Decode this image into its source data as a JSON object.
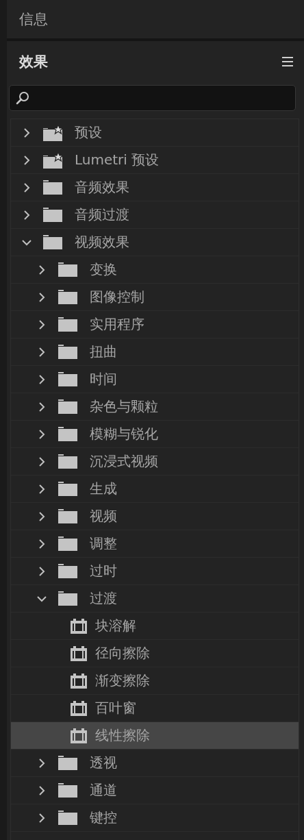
{
  "info_panel": {
    "title": "信息"
  },
  "effects_panel": {
    "title": "效果",
    "tree": [
      {
        "kind": "preset_folder",
        "label": "预设",
        "expanded": false,
        "selected": false
      },
      {
        "kind": "preset_folder",
        "label": "Lumetri 预设",
        "expanded": false,
        "selected": false
      },
      {
        "kind": "folder",
        "label": "音频效果",
        "expanded": false,
        "selected": false
      },
      {
        "kind": "folder",
        "label": "音频过渡",
        "expanded": false,
        "selected": false
      },
      {
        "kind": "folder",
        "label": "视频效果",
        "expanded": true,
        "selected": false,
        "children": [
          {
            "kind": "folder",
            "label": "变换",
            "expanded": false,
            "selected": false
          },
          {
            "kind": "folder",
            "label": "图像控制",
            "expanded": false,
            "selected": false
          },
          {
            "kind": "folder",
            "label": "实用程序",
            "expanded": false,
            "selected": false
          },
          {
            "kind": "folder",
            "label": "扭曲",
            "expanded": false,
            "selected": false
          },
          {
            "kind": "folder",
            "label": "时间",
            "expanded": false,
            "selected": false
          },
          {
            "kind": "folder",
            "label": "杂色与颗粒",
            "expanded": false,
            "selected": false
          },
          {
            "kind": "folder",
            "label": "模糊与锐化",
            "expanded": false,
            "selected": false
          },
          {
            "kind": "folder",
            "label": "沉浸式视频",
            "expanded": false,
            "selected": false
          },
          {
            "kind": "folder",
            "label": "生成",
            "expanded": false,
            "selected": false
          },
          {
            "kind": "folder",
            "label": "视频",
            "expanded": false,
            "selected": false
          },
          {
            "kind": "folder",
            "label": "调整",
            "expanded": false,
            "selected": false
          },
          {
            "kind": "folder",
            "label": "过时",
            "expanded": false,
            "selected": false
          },
          {
            "kind": "folder",
            "label": "过渡",
            "expanded": true,
            "selected": false,
            "children": [
              {
                "kind": "effect",
                "label": "块溶解",
                "selected": false
              },
              {
                "kind": "effect",
                "label": "径向擦除",
                "selected": false
              },
              {
                "kind": "effect",
                "label": "渐变擦除",
                "selected": false
              },
              {
                "kind": "effect",
                "label": "百叶窗",
                "selected": false
              },
              {
                "kind": "effect",
                "label": "线性擦除",
                "selected": true
              }
            ]
          },
          {
            "kind": "folder",
            "label": "透视",
            "expanded": false,
            "selected": false
          },
          {
            "kind": "folder",
            "label": "通道",
            "expanded": false,
            "selected": false
          },
          {
            "kind": "folder",
            "label": "键控",
            "expanded": false,
            "selected": false
          }
        ]
      }
    ]
  }
}
